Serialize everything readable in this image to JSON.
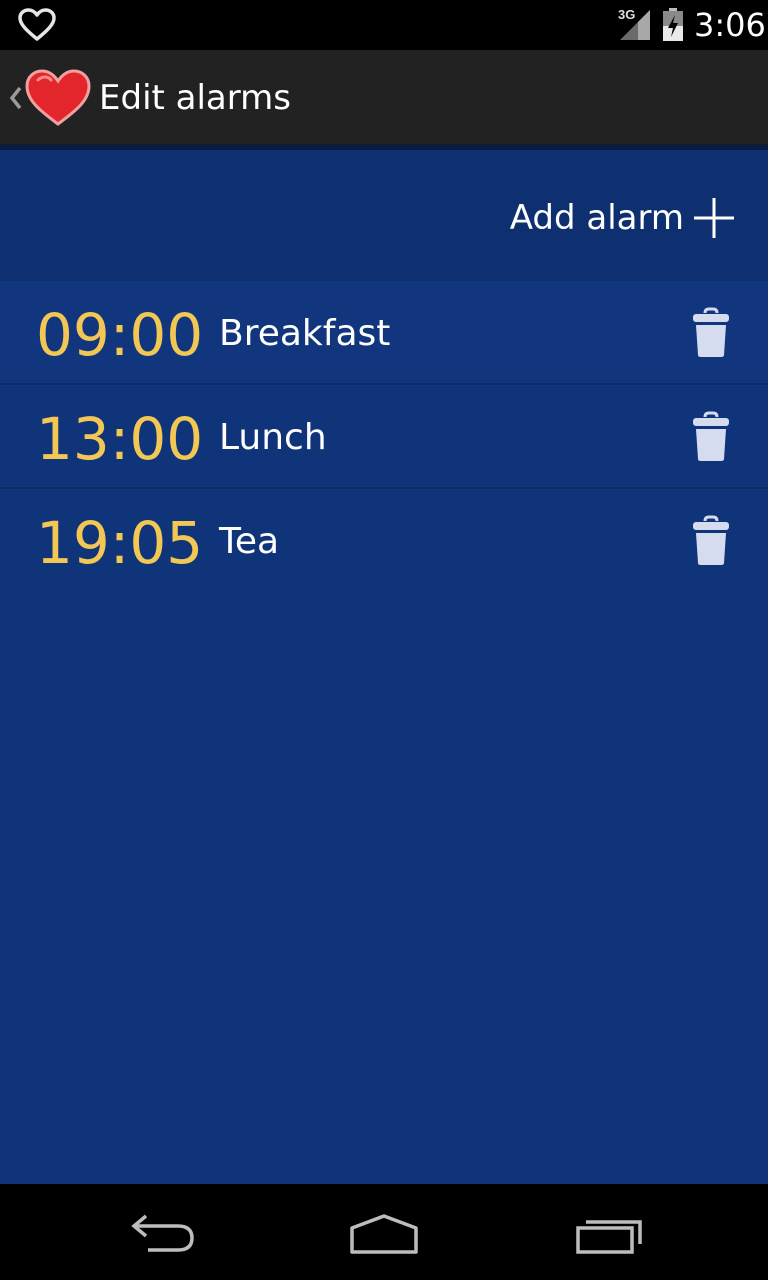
{
  "status_bar": {
    "network_label": "3G",
    "time": "3:06",
    "icons": [
      "heart-outline-icon",
      "signal-icon",
      "battery-charging-icon"
    ]
  },
  "action_bar": {
    "title": "Edit alarms",
    "icons": [
      "up-caret-icon",
      "heart-logo-icon"
    ]
  },
  "toolbar": {
    "add_alarm_label": "Add alarm",
    "add_icon": "plus-icon"
  },
  "alarms": [
    {
      "time": "09:00",
      "name": "Breakfast"
    },
    {
      "time": "13:00",
      "name": "Lunch"
    },
    {
      "time": "19:05",
      "name": "Tea"
    }
  ],
  "nav_bar": {
    "icons": [
      "back-icon",
      "home-icon",
      "recents-icon"
    ]
  },
  "colors": {
    "background": "#10347a",
    "header_row": "#0f3070",
    "time_accent": "#f3c753",
    "action_bar": "#222222",
    "logo_red": "#e3262b"
  }
}
